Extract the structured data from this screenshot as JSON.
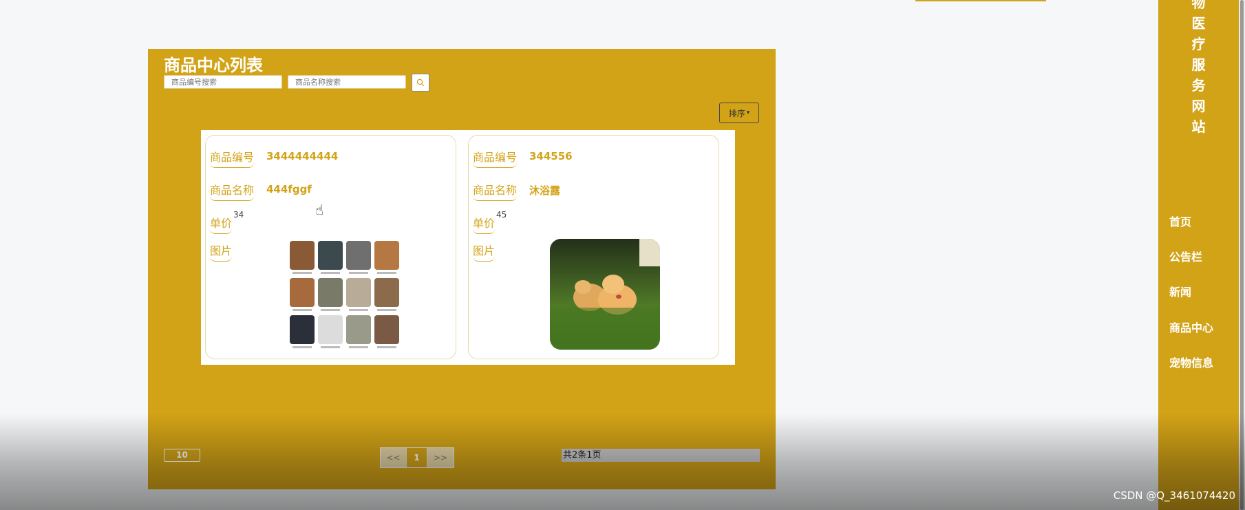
{
  "panel": {
    "title": "商品中心列表",
    "search_code_placeholder": "商品编号搜索",
    "search_name_placeholder": "商品名称搜索",
    "sort_label": "排序"
  },
  "cards": [
    {
      "code_label": "商品编号",
      "code": "3444444444",
      "name_label": "商品名称",
      "name": "444fggf",
      "price_label": "单价",
      "price": "34",
      "image_label": "图片"
    },
    {
      "code_label": "商品编号",
      "code": "344556",
      "name_label": "商品名称",
      "name": "沐浴露",
      "price_label": "单价",
      "price": "45",
      "image_label": "图片"
    }
  ],
  "pagination": {
    "page_size": "10",
    "prev": "<<",
    "current": "1",
    "next": ">>",
    "total": "共2条1页"
  },
  "sidebar": {
    "title_chars": [
      "物",
      "医",
      "疗",
      "服",
      "务",
      "网",
      "站"
    ],
    "nav": [
      "首页",
      "公告栏",
      "新闻",
      "商品中心",
      "宠物信息"
    ]
  },
  "watermark": "CSDN @Q_3461074420",
  "colors": {
    "brand": "#d3a317",
    "panel_text": "#ffffff"
  }
}
